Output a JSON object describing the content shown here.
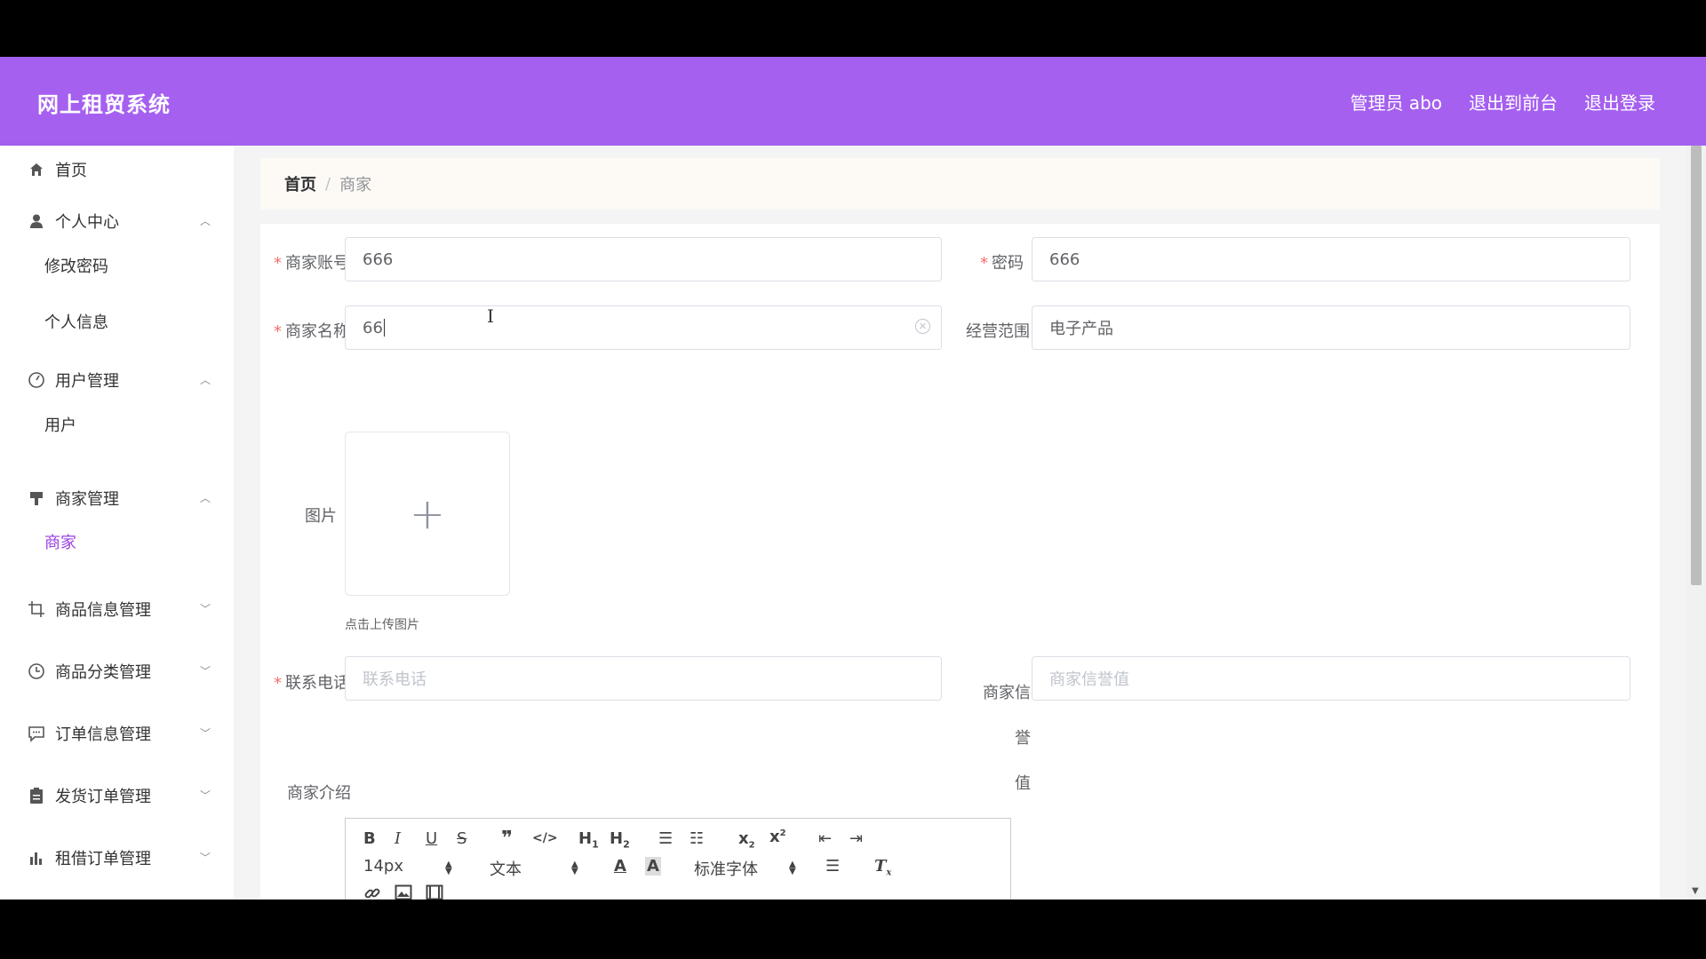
{
  "header": {
    "brand": "网上租贸系统",
    "admin": "管理员 abo",
    "back_front": "退出到前台",
    "logout": "退出登录"
  },
  "sidebar": {
    "items": [
      {
        "label": "首页",
        "icon": "home-icon"
      },
      {
        "label": "个人中心",
        "icon": "user-icon",
        "expanded": true
      },
      {
        "label": "用户管理",
        "icon": "gauge-icon",
        "expanded": true
      },
      {
        "label": "商家管理",
        "icon": "brush-icon",
        "expanded": true
      },
      {
        "label": "商品信息管理",
        "icon": "crop-icon",
        "expanded": false
      },
      {
        "label": "商品分类管理",
        "icon": "clock-icon",
        "expanded": false
      },
      {
        "label": "订单信息管理",
        "icon": "message-icon",
        "expanded": false
      },
      {
        "label": "发货订单管理",
        "icon": "clipboard-icon",
        "expanded": false
      },
      {
        "label": "租借订单管理",
        "icon": "chart-icon",
        "expanded": false
      }
    ],
    "subitems": {
      "change_password": "修改密码",
      "personal_info": "个人信息",
      "user": "用户",
      "merchant": "商家"
    }
  },
  "breadcrumb": {
    "home": "首页",
    "current": "商家"
  },
  "form": {
    "account_label": "商家账号",
    "account_value": "666",
    "password_label": "密码",
    "password_value": "666",
    "name_label": "商家名称",
    "name_value": "66",
    "scope_label": "经营范围",
    "scope_value": "电子产品",
    "image_label": "图片",
    "upload_tip": "点击上传图片",
    "phone_label": "联系电话",
    "phone_placeholder": "联系电话",
    "credit_label_line1": "商家信誉",
    "credit_label_line2": "值",
    "credit_placeholder": "商家信誉值",
    "intro_label": "商家介绍"
  },
  "editor": {
    "font_size": "14px",
    "text_type": "文本",
    "font_family": "标准字体"
  },
  "colors": {
    "header_bg": "#a560f0",
    "active_menu": "#9b3fe0",
    "required": "#f56c6c"
  }
}
